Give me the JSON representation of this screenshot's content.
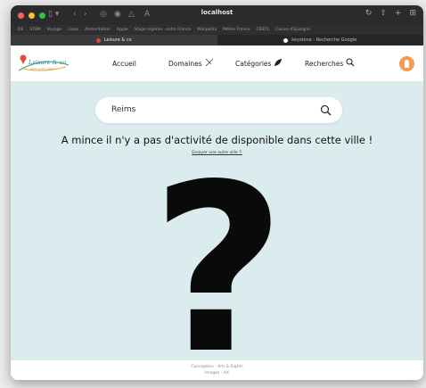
{
  "browser": {
    "url": "localhost",
    "favorites": [
      "DE",
      "ST8M",
      "Voyage",
      "Lieux",
      "Alimentation",
      "Apple",
      "Stage Ingénie...entrs France",
      "Wikipédia",
      "Météo France",
      "CRBTL",
      "Caisse d'Épargne"
    ],
    "tabs": [
      {
        "label": "Leisure & co"
      },
      {
        "label": "keystone - Recherche Google"
      }
    ]
  },
  "site": {
    "logo_text": "Leisure & co",
    "logo_tagline": "Votre guide loisirs",
    "nav": {
      "home": "Accueil",
      "domains": "Domaines",
      "categories": "Catégories",
      "search": "Recherches"
    }
  },
  "main": {
    "search_value": "Reims",
    "headline": "A mince il n'y a pas d'activité de disponible dans cette ville !",
    "retry_link": "Essayer une autre ville !!",
    "qmark": "?"
  },
  "footer": {
    "line1": "Conception · Arti & Rights",
    "line2": "Images · AX"
  },
  "colors": {
    "main_bg": "#dbecef",
    "avatar": "#f39a53",
    "logo": "#2e7fb5"
  }
}
